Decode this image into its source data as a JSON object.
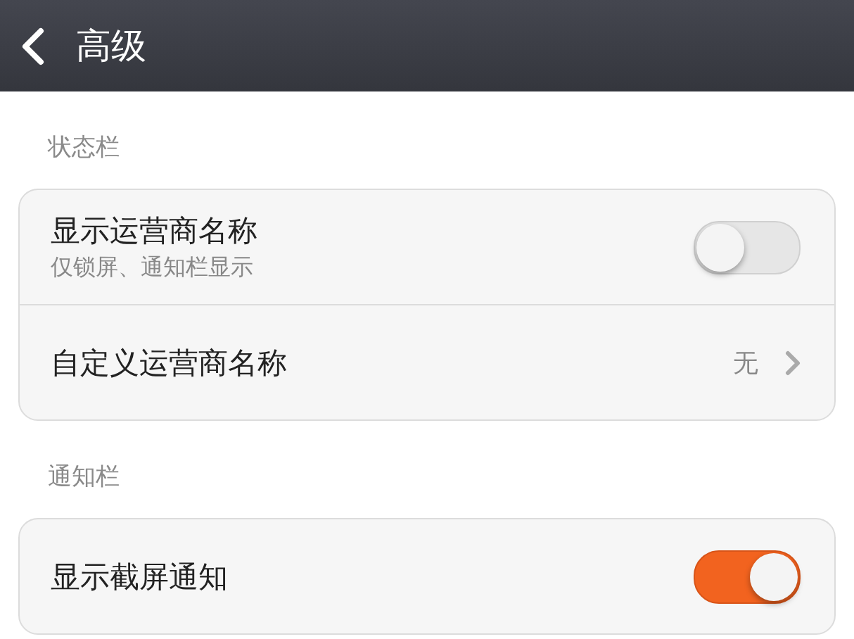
{
  "header": {
    "title": "高级"
  },
  "sections": [
    {
      "title": "状态栏",
      "items": [
        {
          "kind": "toggle",
          "label": "显示运营商名称",
          "subtitle": "仅锁屏、通知栏显示",
          "on": false
        },
        {
          "kind": "link",
          "label": "自定义运营商名称",
          "value": "无"
        }
      ]
    },
    {
      "title": "通知栏",
      "items": [
        {
          "kind": "toggle",
          "label": "显示截屏通知",
          "on": true
        }
      ]
    }
  ]
}
